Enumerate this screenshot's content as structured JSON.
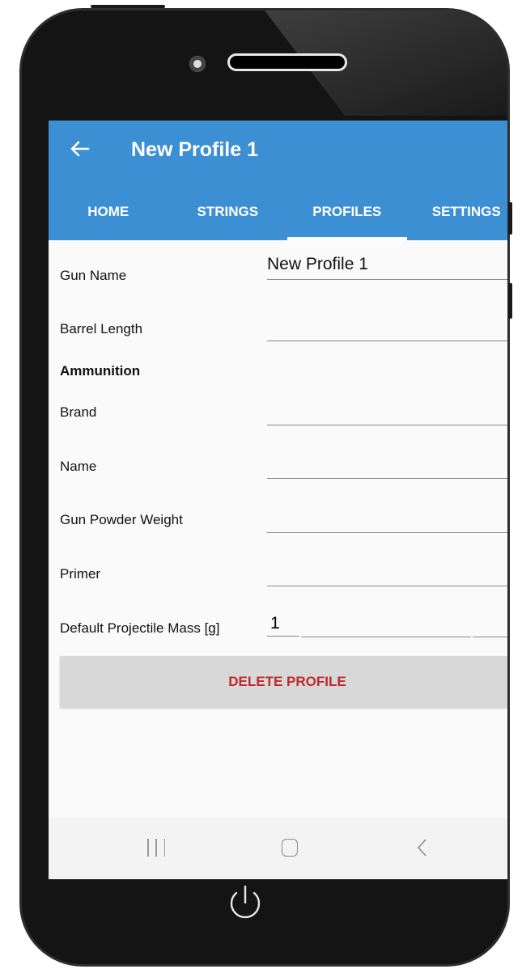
{
  "appbar": {
    "title": "New Profile 1",
    "back_icon": "arrow-left-icon",
    "color": "#3d8fd4"
  },
  "tabs": [
    {
      "label": "HOME",
      "active": false
    },
    {
      "label": "STRINGS",
      "active": false
    },
    {
      "label": "PROFILES",
      "active": true
    },
    {
      "label": "SETTINGS",
      "active": false
    }
  ],
  "form": {
    "gun_name": {
      "label": "Gun Name",
      "value": "New Profile 1"
    },
    "barrel_length": {
      "label": "Barrel Length",
      "value": ""
    },
    "ammunition_heading": "Ammunition",
    "brand": {
      "label": "Brand",
      "value": ""
    },
    "name": {
      "label": "Name",
      "value": ""
    },
    "powder_weight": {
      "label": "Gun Powder Weight",
      "value": ""
    },
    "primer": {
      "label": "Primer",
      "value": ""
    },
    "projectile_mass": {
      "label": "Default Projectile Mass [g]",
      "value": "1"
    }
  },
  "delete_button": {
    "label": "DELETE PROFILE",
    "text_color": "#c0292b"
  },
  "system_nav": {
    "recent": "recent-apps-icon",
    "home": "home-icon",
    "back": "back-chevron-icon"
  }
}
